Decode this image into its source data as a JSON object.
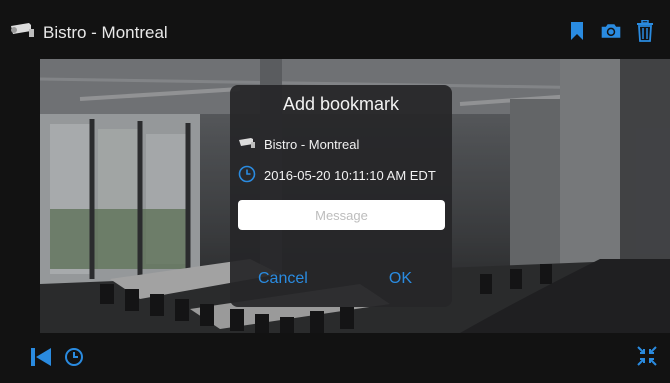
{
  "header": {
    "camera_name": "Bistro - Montreal",
    "icons": [
      "camera-icon",
      "bookmark-icon",
      "snapshot-icon",
      "trash-icon"
    ]
  },
  "dialog": {
    "title": "Add bookmark",
    "camera_name": "Bistro - Montreal",
    "timestamp": "2016-05-20 10:11:10 AM EDT",
    "message_placeholder": "Message",
    "message_value": "",
    "cancel_label": "Cancel",
    "ok_label": "OK"
  },
  "footer": {
    "icons": [
      "skip-back-icon",
      "clock-icon",
      "collapse-icon"
    ]
  },
  "colors": {
    "accent": "#2a8be0",
    "bar_background": "#121212",
    "dialog_background": "#262628",
    "text": "#f2f2f2"
  }
}
